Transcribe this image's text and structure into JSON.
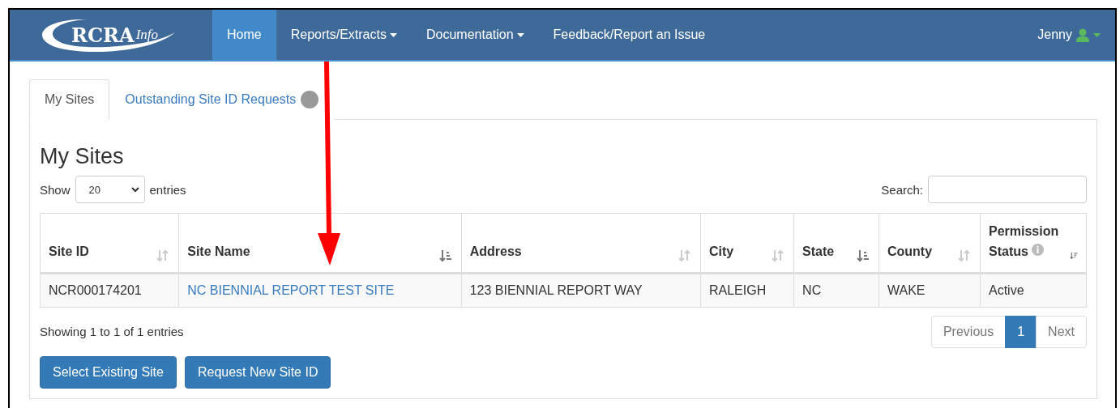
{
  "navbar": {
    "logo": {
      "text": "RCRA",
      "script": "Info"
    },
    "items": [
      {
        "label": "Home",
        "selected": true,
        "dropdown": false
      },
      {
        "label": "Reports/Extracts",
        "selected": false,
        "dropdown": true
      },
      {
        "label": "Documentation",
        "selected": false,
        "dropdown": true
      },
      {
        "label": "Feedback/Report an Issue",
        "selected": false,
        "dropdown": false
      }
    ],
    "user": "Jenny"
  },
  "tabs": [
    {
      "label": "My Sites",
      "selected": true,
      "badge": false
    },
    {
      "label": "Outstanding Site ID Requests",
      "selected": false,
      "badge": true
    }
  ],
  "heading": "My Sites",
  "length_menu": {
    "before": "Show",
    "value": "20",
    "after": "entries"
  },
  "search": {
    "label": "Search:"
  },
  "table": {
    "columns": [
      {
        "label": "Site ID",
        "kind": "unsorted",
        "info": false
      },
      {
        "label": "Site Name",
        "kind": "alpha",
        "info": false
      },
      {
        "label": "Address",
        "kind": "unsorted",
        "info": false
      },
      {
        "label": "City",
        "kind": "unsorted",
        "info": false
      },
      {
        "label": "State",
        "kind": "alpha",
        "info": false
      },
      {
        "label": "County",
        "kind": "unsorted",
        "info": false
      },
      {
        "label": "Permission Status",
        "kind": "amount",
        "info": true
      }
    ],
    "rows": [
      [
        {
          "text": "NCR000174201",
          "link": false
        },
        {
          "text": "NC BIENNIAL REPORT TEST SITE",
          "link": true
        },
        {
          "text": "123 BIENNIAL REPORT WAY",
          "link": false
        },
        {
          "text": "RALEIGH",
          "link": false
        },
        {
          "text": "NC",
          "link": false
        },
        {
          "text": "WAKE",
          "link": false
        },
        {
          "text": "Active",
          "link": false
        }
      ]
    ]
  },
  "info": "Showing 1 to 1 of 1 entries",
  "pagination": [
    {
      "label": "Previous",
      "selected": false
    },
    {
      "label": "1",
      "selected": true
    },
    {
      "label": "Next",
      "selected": false
    }
  ],
  "buttons": [
    "Select Existing Site",
    "Request New Site ID"
  ],
  "annotation": {
    "arrow": true
  }
}
